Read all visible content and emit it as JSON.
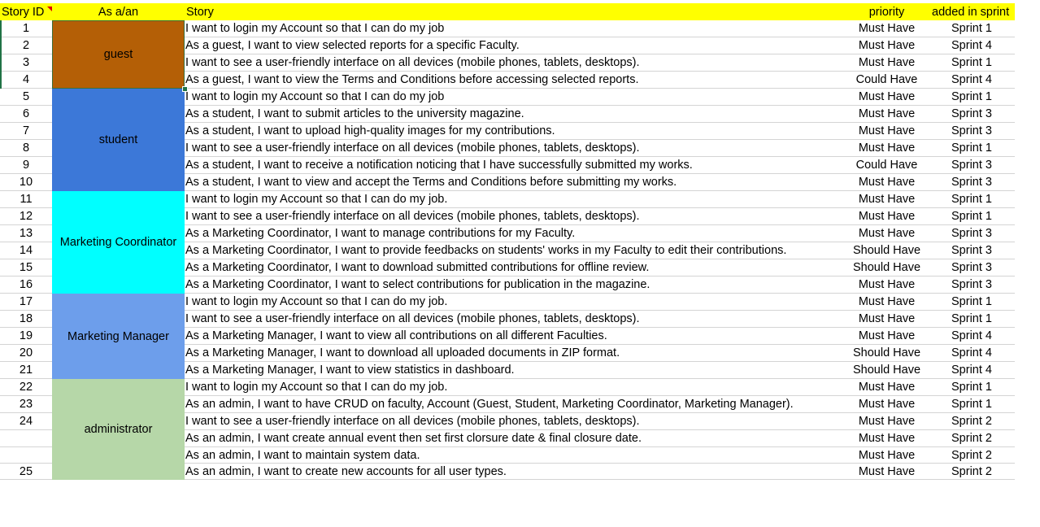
{
  "headers": {
    "id": "Story ID",
    "role": "As a/an",
    "story": "Story",
    "priority": "priority",
    "sprint": "added in sprint"
  },
  "colors": {
    "header": "#ffff00",
    "guest": "#b45f06",
    "student": "#3c78d8",
    "marketing_coordinator": "#00ffff",
    "marketing_manager": "#6d9eeb",
    "administrator": "#b6d7a8"
  },
  "roles": [
    {
      "label": "guest",
      "start": 0,
      "count": 4,
      "color": "#b45f06"
    },
    {
      "label": "student",
      "start": 4,
      "count": 6,
      "color": "#3c78d8"
    },
    {
      "label": "Marketing Coordinator",
      "start": 10,
      "count": 6,
      "color": "#00ffff"
    },
    {
      "label": "Marketing Manager",
      "start": 16,
      "count": 5,
      "color": "#6d9eeb"
    },
    {
      "label": "administrator",
      "start": 21,
      "count": 6,
      "color": "#b6d7a8"
    }
  ],
  "rows": [
    {
      "id": "1",
      "story": "I want to login my Account so that I can do my job",
      "priority": "Must Have",
      "sprint": "Sprint 1"
    },
    {
      "id": "2",
      "story": "As a guest, I want to view selected reports for a specific Faculty.",
      "priority": "Must Have",
      "sprint": "Sprint 4"
    },
    {
      "id": "3",
      "story": "I want to see a user-friendly interface on all devices (mobile phones, tablets, desktops).",
      "priority": "Must Have",
      "sprint": "Sprint 1"
    },
    {
      "id": "4",
      "story": "As a guest, I want to view the Terms and Conditions before accessing selected reports.",
      "priority": "Could Have",
      "sprint": "Sprint 4"
    },
    {
      "id": "5",
      "story": "I want to login my Account so that I can do my job",
      "priority": "Must Have",
      "sprint": "Sprint 1"
    },
    {
      "id": "6",
      "story": "As a student, I want to submit articles to the university magazine.",
      "priority": "Must Have",
      "sprint": "Sprint 3"
    },
    {
      "id": "7",
      "story": "As a student, I want to upload high-quality images for my contributions.",
      "priority": "Must Have",
      "sprint": "Sprint 3"
    },
    {
      "id": "8",
      "story": "I want to see a user-friendly interface on all devices (mobile phones, tablets, desktops).",
      "priority": "Must Have",
      "sprint": "Sprint 1"
    },
    {
      "id": "9",
      "story": "As a student, I want to receive a notification noticing that I have successfully submitted my works.",
      "priority": "Could Have",
      "sprint": "Sprint 3"
    },
    {
      "id": "10",
      "story": "As a student, I want to view and accept the Terms and Conditions before submitting my works.",
      "priority": "Must Have",
      "sprint": "Sprint 3"
    },
    {
      "id": "11",
      "story": "I want to login my Account so that I can do my job.",
      "priority": "Must Have",
      "sprint": "Sprint 1"
    },
    {
      "id": "12",
      "story": "I want to see a user-friendly interface on all devices (mobile phones, tablets, desktops).",
      "priority": "Must Have",
      "sprint": "Sprint 1"
    },
    {
      "id": "13",
      "story": "As a Marketing Coordinator, I want to manage contributions for my Faculty.",
      "priority": "Must Have",
      "sprint": "Sprint 3"
    },
    {
      "id": "14",
      "story": "As a Marketing Coordinator, I want to provide feedbacks on students' works in my Faculty to edit their contributions.",
      "priority": "Should Have",
      "sprint": "Sprint 3"
    },
    {
      "id": "15",
      "story": "As a Marketing Coordinator, I want to download submitted contributions for offline review.",
      "priority": "Should Have",
      "sprint": "Sprint 3"
    },
    {
      "id": "16",
      "story": "As a Marketing Coordinator, I want to select contributions for publication in the magazine.",
      "priority": "Must Have",
      "sprint": "Sprint 3"
    },
    {
      "id": "17",
      "story": "I want to login my Account so that I can do my job.",
      "priority": "Must Have",
      "sprint": "Sprint 1"
    },
    {
      "id": "18",
      "story": "I want to see a user-friendly interface on all devices (mobile phones, tablets, desktops).",
      "priority": "Must Have",
      "sprint": "Sprint 1"
    },
    {
      "id": "19",
      "story": "As a Marketing Manager, I want to view all contributions on all different Faculties.",
      "priority": "Must Have",
      "sprint": "Sprint 4"
    },
    {
      "id": "20",
      "story": "As a Marketing Manager, I want to download all uploaded documents in ZIP format.",
      "priority": "Should Have",
      "sprint": "Sprint 4"
    },
    {
      "id": "21",
      "story": "As a Marketing Manager, I want to view statistics in dashboard.",
      "priority": "Should Have",
      "sprint": "Sprint 4"
    },
    {
      "id": "22",
      "story": "I want to login my Account so that I can do my job.",
      "priority": "Must Have",
      "sprint": "Sprint 1"
    },
    {
      "id": "23",
      "story": "As an admin, I want to have CRUD on faculty, Account (Guest, Student, Marketing Coordinator, Marketing Manager).",
      "priority": "Must Have",
      "sprint": "Sprint 1"
    },
    {
      "id": "24",
      "story": "I want to see a user-friendly interface on all devices (mobile phones, tablets, desktops).",
      "priority": "Must Have",
      "sprint": "Sprint 2"
    },
    {
      "id": "",
      "story": "As an admin, I want create annual event then set first clorsure date & final closure date.",
      "priority": "Must Have",
      "sprint": "Sprint 2"
    },
    {
      "id": "",
      "story": "As an admin, I want to maintain system data.",
      "priority": "Must Have",
      "sprint": "Sprint 2"
    },
    {
      "id": "25",
      "story": "As an admin, I want to create new accounts for all user types.",
      "priority": "Must Have",
      "sprint": "Sprint 2"
    }
  ]
}
